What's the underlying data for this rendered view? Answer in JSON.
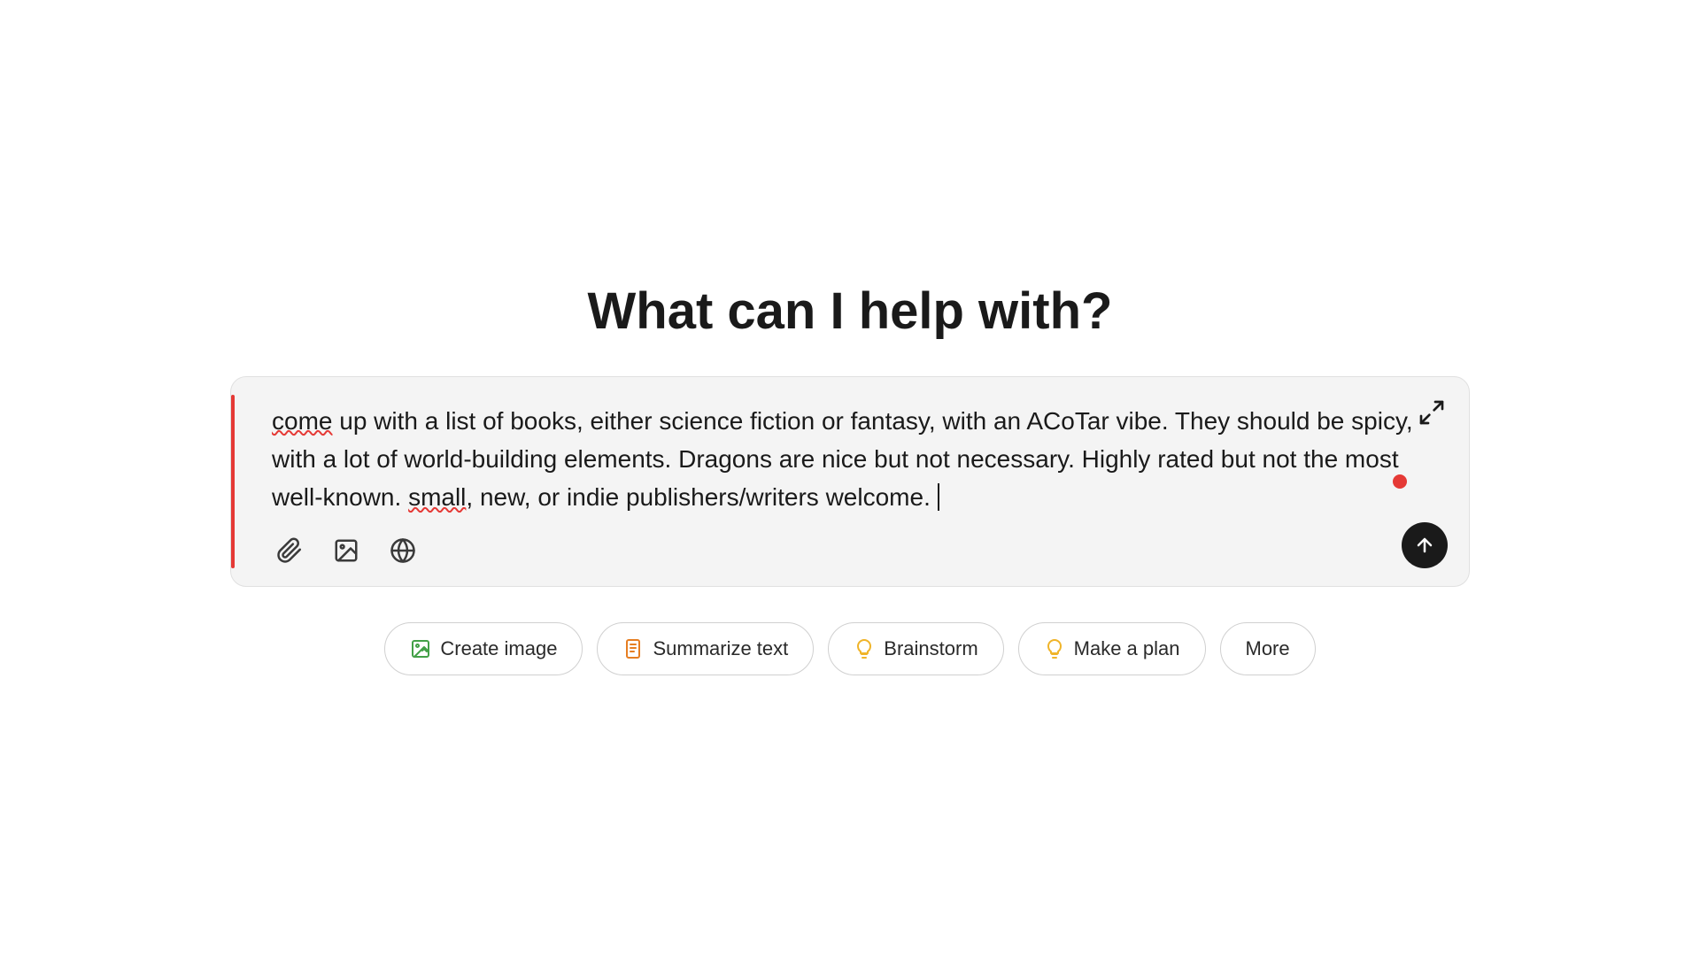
{
  "page": {
    "title": "What can I help with?",
    "background": "#ffffff"
  },
  "input": {
    "text_line1": "come up with a list of books, either science fiction or fantasy, with an ACoTar vibe. They should be",
    "text_line2": "spicy, with a lot of world-building elements. Dragons are nice but not necessary. Highly rated but",
    "text_line3": "not the most well-known. small, new, or indie publishers/writers welcome.",
    "spell_error_words": [
      "come",
      "small"
    ],
    "expand_label": "expand",
    "record_indicator": "recording"
  },
  "toolbar": {
    "attach_label": "attach file",
    "media_label": "media",
    "web_label": "web search",
    "send_label": "send"
  },
  "action_buttons": [
    {
      "id": "create-image",
      "icon": "create-image-icon",
      "label": "Create image",
      "icon_char": "⚡"
    },
    {
      "id": "summarize-text",
      "icon": "summarize-icon",
      "label": "Summarize text",
      "icon_char": "📄"
    },
    {
      "id": "brainstorm",
      "icon": "brainstorm-icon",
      "label": "Brainstorm",
      "icon_char": "💡"
    },
    {
      "id": "make-a-plan",
      "icon": "plan-icon",
      "label": "Make a plan",
      "icon_char": "💡"
    },
    {
      "id": "more",
      "icon": "more-icon",
      "label": "More",
      "icon_char": ""
    }
  ]
}
